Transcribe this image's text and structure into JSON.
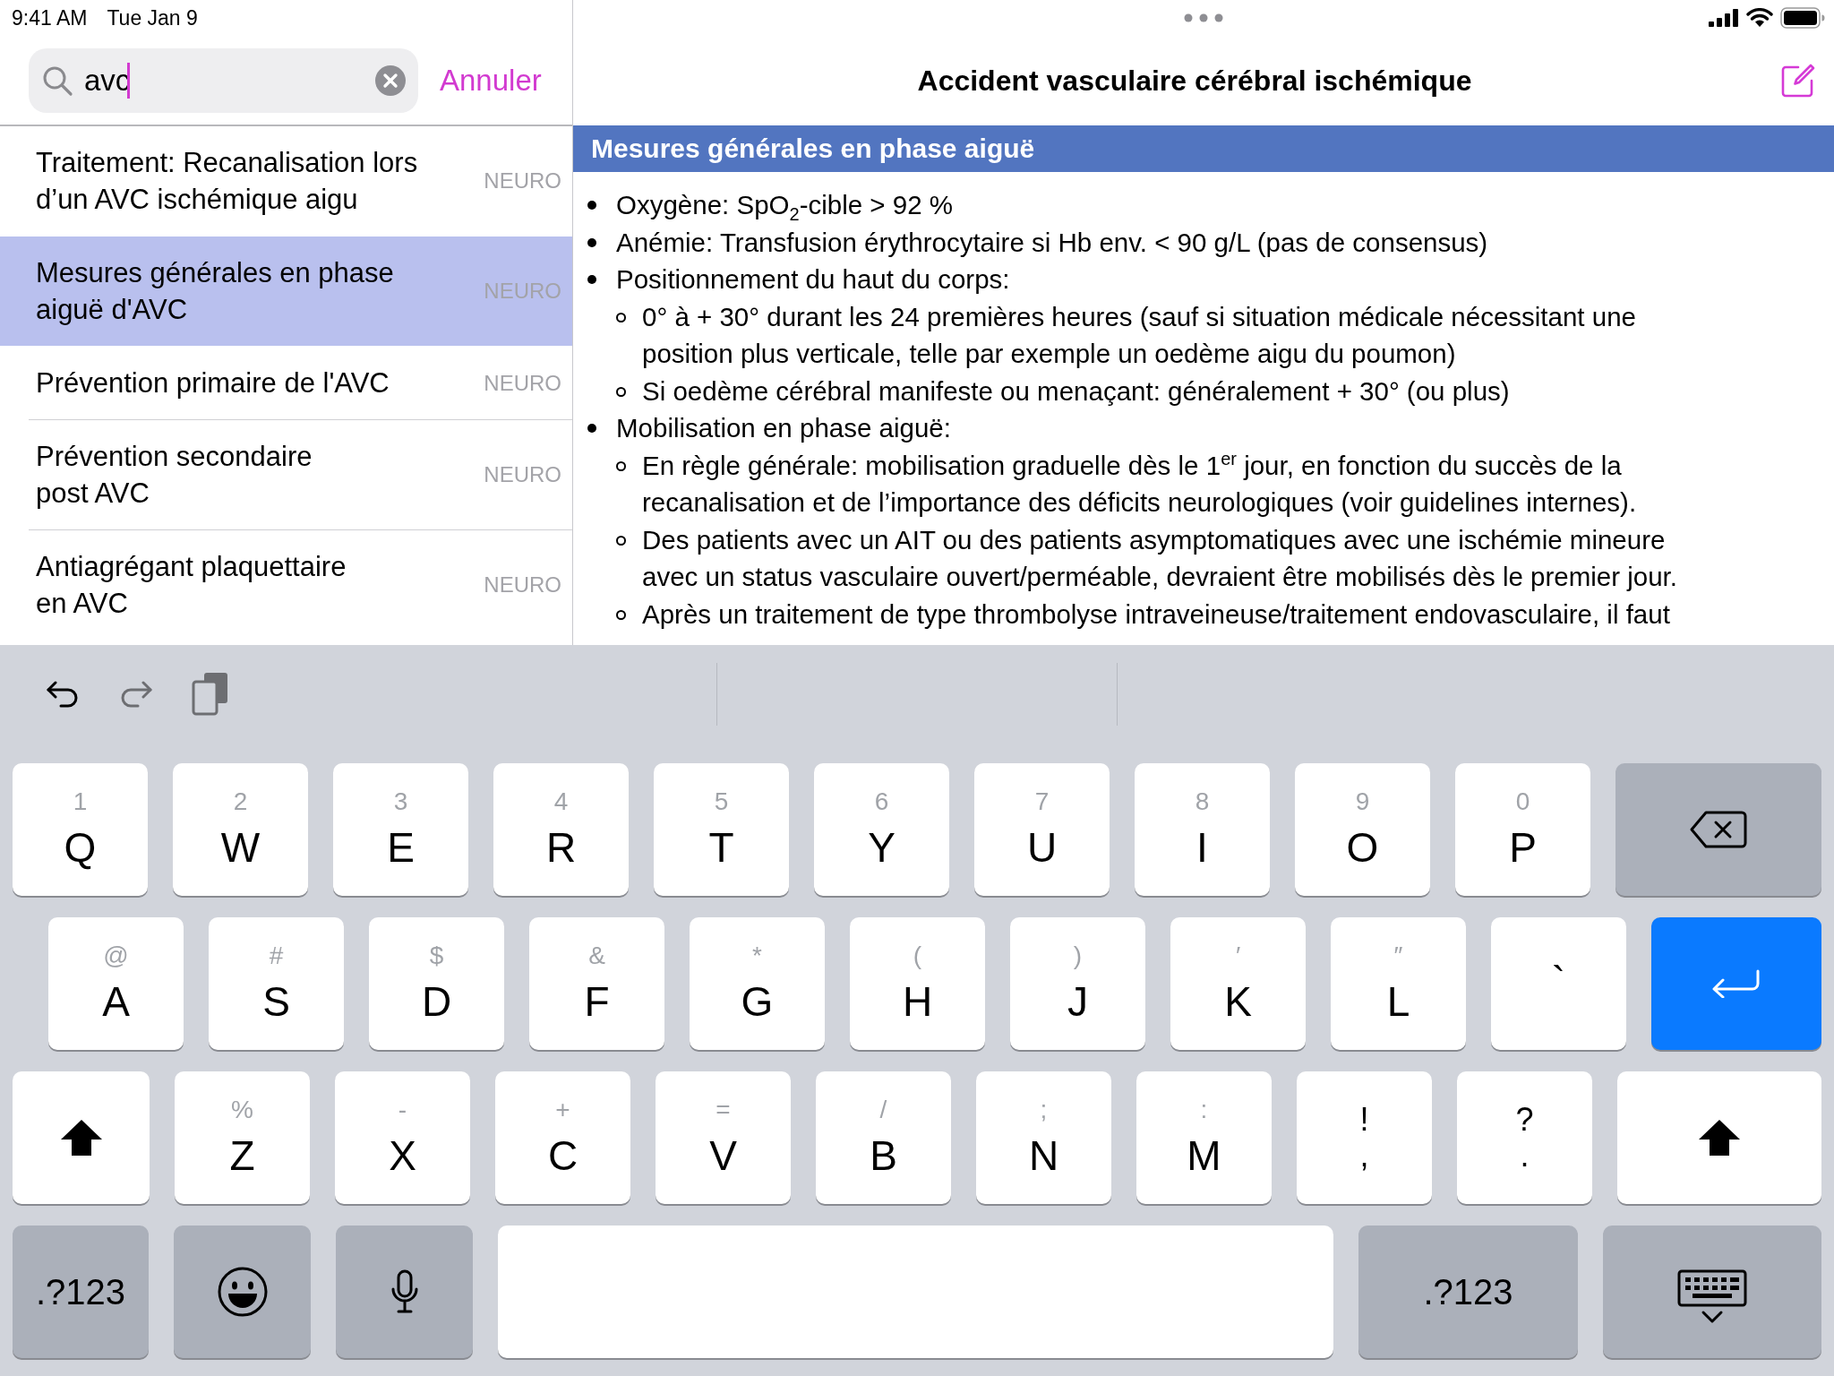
{
  "status_bar": {
    "time": "9:41 AM",
    "date": "Tue Jan 9"
  },
  "search": {
    "value": "avc",
    "cancel": "Annuler"
  },
  "results": [
    {
      "title": "Traitement: Recanalisation lors\nd’un AVC ischémique aigu",
      "tag": "NEURO",
      "selected": false
    },
    {
      "title": "Mesures générales en phase\naiguë d'AVC",
      "tag": "NEURO",
      "selected": true
    },
    {
      "title": "Prévention primaire de l'AVC",
      "tag": "NEURO",
      "selected": false
    },
    {
      "title": "Prévention secondaire\npost AVC",
      "tag": "NEURO",
      "selected": false
    },
    {
      "title": "Antiagrégant plaquettaire\nen AVC",
      "tag": "NEURO",
      "selected": false
    }
  ],
  "article": {
    "title": "Accident vasculaire cérébral ischémique",
    "section": "Mesures générales en phase aiguë",
    "items": [
      {
        "text": "Oxygène: SpO$_{2}$-cible > 92 %"
      },
      {
        "text": "Anémie: Transfusion érythrocytaire si Hb env. < 90 g/L (pas de consensus)"
      },
      {
        "text": "Positionnement du haut du corps:",
        "children": [
          {
            "text": "0° à + 30° durant les 24 premières heures (sauf si situation médicale nécessitant une\nposition plus verticale, telle par exemple un oedème aigu du poumon)"
          },
          {
            "text": "Si oedème cérébral manifeste ou menaçant: généralement + 30° (ou plus)"
          }
        ]
      },
      {
        "text": "Mobilisation en phase aiguë:",
        "children": [
          {
            "text": "En règle générale: mobilisation graduelle dès le 1$^{er}$ jour, en fonction du succès de la\nrecanalisation et de l’importance des déficits neurologiques (voir guidelines internes)."
          },
          {
            "text": "Des patients avec un AIT ou des patients asymptomatiques avec une ischémie mineure\navec un status vasculaire ouvert/perméable, devraient être mobilisés dès le premier jour."
          },
          {
            "text": "Après un traitement de type thrombolyse intraveineuse/traitement endovasculaire, il faut"
          }
        ]
      }
    ]
  },
  "keyboard": {
    "rows": [
      [
        {
          "kind": "char",
          "label": "Q",
          "alt": "1"
        },
        {
          "kind": "char",
          "label": "W",
          "alt": "2"
        },
        {
          "kind": "char",
          "label": "E",
          "alt": "3"
        },
        {
          "kind": "char",
          "label": "R",
          "alt": "4"
        },
        {
          "kind": "char",
          "label": "T",
          "alt": "5"
        },
        {
          "kind": "char",
          "label": "Y",
          "alt": "6"
        },
        {
          "kind": "char",
          "label": "U",
          "alt": "7"
        },
        {
          "kind": "char",
          "label": "I",
          "alt": "8"
        },
        {
          "kind": "char",
          "label": "O",
          "alt": "9"
        },
        {
          "kind": "char",
          "label": "P",
          "alt": "0"
        },
        {
          "kind": "backspace"
        }
      ],
      [
        {
          "kind": "char",
          "label": "A",
          "alt": "@"
        },
        {
          "kind": "char",
          "label": "S",
          "alt": "#"
        },
        {
          "kind": "char",
          "label": "D",
          "alt": "$"
        },
        {
          "kind": "char",
          "label": "F",
          "alt": "&"
        },
        {
          "kind": "char",
          "label": "G",
          "alt": "*"
        },
        {
          "kind": "char",
          "label": "H",
          "alt": "("
        },
        {
          "kind": "char",
          "label": "J",
          "alt": ")"
        },
        {
          "kind": "char",
          "label": "K",
          "alt": "′"
        },
        {
          "kind": "char",
          "label": "L",
          "alt": "″"
        },
        {
          "kind": "char",
          "label": "`"
        },
        {
          "kind": "return"
        }
      ],
      [
        {
          "kind": "shift"
        },
        {
          "kind": "char",
          "label": "Z",
          "alt": "%"
        },
        {
          "kind": "char",
          "label": "X",
          "alt": "-"
        },
        {
          "kind": "char",
          "label": "C",
          "alt": "+"
        },
        {
          "kind": "char",
          "label": "V",
          "alt": "="
        },
        {
          "kind": "char",
          "label": "B",
          "alt": "/"
        },
        {
          "kind": "char",
          "label": "N",
          "alt": ";"
        },
        {
          "kind": "char",
          "label": "M",
          "alt": ":"
        },
        {
          "kind": "punct",
          "label": ",",
          "alt": "!"
        },
        {
          "kind": "punct",
          "label": ".",
          "alt": "?"
        },
        {
          "kind": "shift"
        }
      ],
      [
        {
          "kind": "numbers",
          "label": ".?123"
        },
        {
          "kind": "emoji"
        },
        {
          "kind": "dictation"
        },
        {
          "kind": "space"
        },
        {
          "kind": "numbers",
          "label": ".?123"
        },
        {
          "kind": "hide"
        }
      ]
    ]
  }
}
